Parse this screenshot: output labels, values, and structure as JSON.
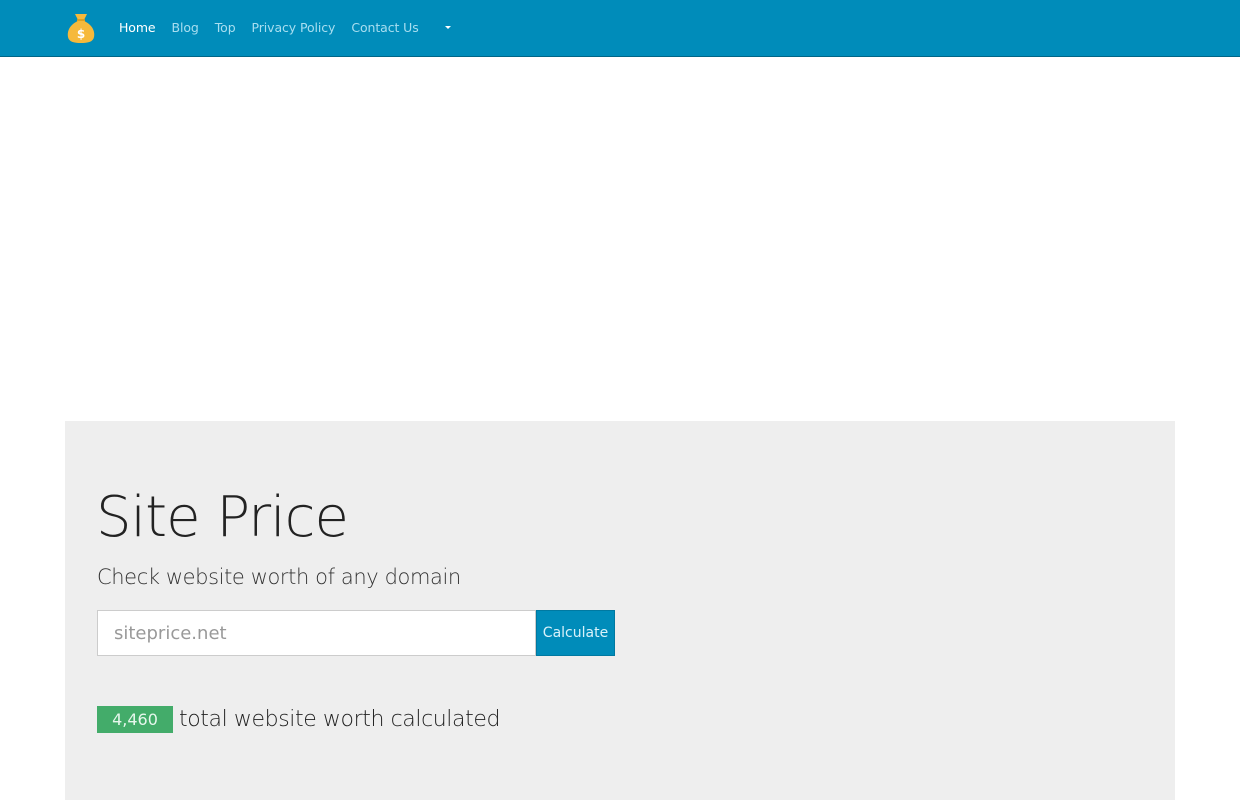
{
  "colors": {
    "navbar": "#008cba",
    "jumbotron": "#eeeeee",
    "button": "#008cba",
    "badge": "#43ac6a",
    "logo": "#f6b93b"
  },
  "navbar": {
    "logo_icon": "money-bag-icon",
    "logo_glyph": "$",
    "items": [
      {
        "label": "Home",
        "active": true
      },
      {
        "label": "Blog",
        "active": false
      },
      {
        "label": "Top",
        "active": false
      },
      {
        "label": "Privacy Policy",
        "active": false
      },
      {
        "label": "Contact Us",
        "active": false
      }
    ],
    "dropdown_icon": "caret-down-icon"
  },
  "hero": {
    "title": "Site Price",
    "subtitle": "Check website worth of any domain",
    "search": {
      "placeholder": "siteprice.net",
      "value": ""
    },
    "calculate_label": "Calculate",
    "stat": {
      "count": "4,460",
      "text": "total website worth calculated"
    }
  }
}
